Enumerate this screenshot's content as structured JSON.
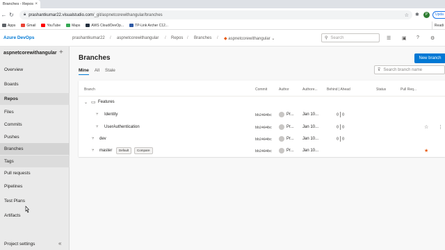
{
  "browser": {
    "tab_title": "Branches - Repos",
    "url_host": "prashantkumar22.visualstudio.com",
    "url_path": "/_git/aspnetcorewithangular/branches",
    "update_label": "Upda",
    "profile_initial": "P",
    "bookmarks": [
      {
        "label": "Apps",
        "color": "#5f6368"
      },
      {
        "label": "Gmail",
        "color": "#ea4335"
      },
      {
        "label": "YouTube",
        "color": "#ff0000"
      },
      {
        "label": "Maps",
        "color": "#34a853"
      },
      {
        "label": "AWS Cloud/DevOp...",
        "color": "#232f3e"
      },
      {
        "label": "TP-Link Archer C12...",
        "color": "#2f5aa5"
      }
    ],
    "reading_list": "Readi"
  },
  "header": {
    "brand": "Azure DevOps",
    "breadcrumbs": [
      "prashantkumar22",
      "aspnetcorewithangular",
      "Repos",
      "Branches",
      "aspnetcorewithangular"
    ],
    "search_placeholder": "Search"
  },
  "sidebar": {
    "project": "aspnetcorewithangular",
    "items": [
      {
        "label": "Overview"
      },
      {
        "label": "Boards"
      },
      {
        "label": "Repos"
      },
      {
        "label": "Files"
      },
      {
        "label": "Commits"
      },
      {
        "label": "Pushes"
      },
      {
        "label": "Branches"
      },
      {
        "label": "Tags"
      },
      {
        "label": "Pull requests"
      },
      {
        "label": "Pipelines"
      },
      {
        "label": "Test Plans"
      },
      {
        "label": "Artifacts"
      }
    ],
    "footer": "Project settings"
  },
  "main": {
    "title": "Branches",
    "new_branch_label": "New branch",
    "filter_tabs": [
      "Mine",
      "All",
      "Stale"
    ],
    "search_placeholder": "Search branch name",
    "columns": [
      "Branch",
      "Commit",
      "Author",
      "Authore...",
      "Behind | Ahead",
      "Status",
      "Pull Req..."
    ],
    "folder": {
      "label": "Features"
    },
    "rows": [
      {
        "name": "Identity",
        "commit": "bb2494bc",
        "author": "Pr...",
        "date": "Jan 10...",
        "behind": "0",
        "ahead": "0"
      },
      {
        "name": "UserAuthentication",
        "commit": "bb2494bc",
        "author": "Pr...",
        "date": "Jan 10...",
        "behind": "0",
        "ahead": "0"
      },
      {
        "name": "dev",
        "commit": "bb2494bc",
        "author": "Pr...",
        "date": "Jan 10...",
        "behind": "0",
        "ahead": "0"
      },
      {
        "name": "master",
        "commit": "bb2494bc",
        "author": "Pr...",
        "date": "Jan 10...",
        "default_badge": "Default",
        "compare_badge": "Compare"
      }
    ],
    "star_color": "#e8590c"
  }
}
